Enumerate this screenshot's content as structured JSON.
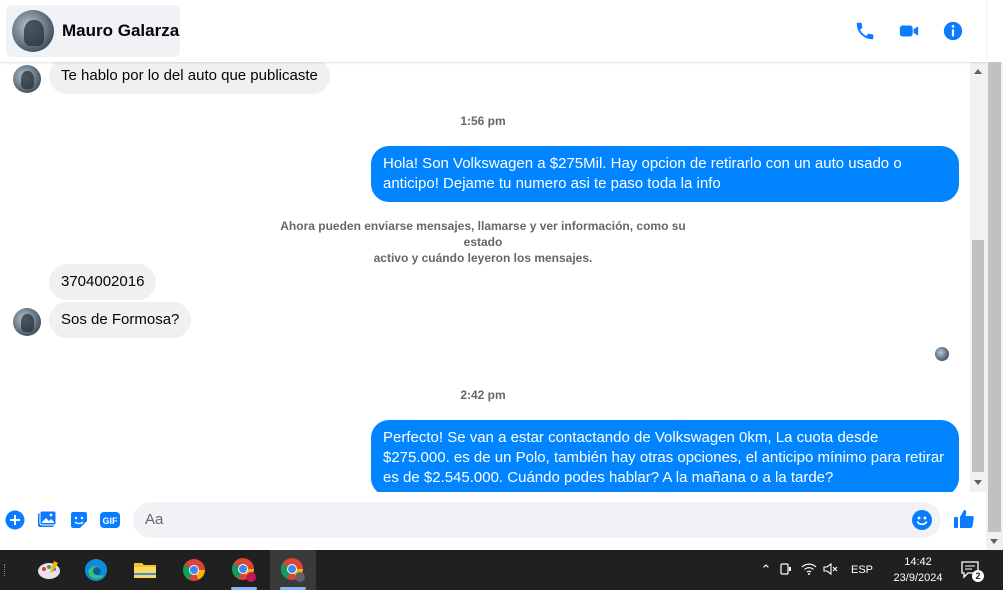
{
  "header": {
    "contact_name": "Mauro Galarza",
    "icons": [
      "phone-icon",
      "video-icon",
      "info-icon"
    ]
  },
  "messages": {
    "m1": "Te hablo por lo del auto que publicaste",
    "time1": "1:56 pm",
    "m2": "Hola! Son Volkswagen a $275Mil. Hay opcion de retirarlo con un auto usado o anticipo! Dejame tu numero asi te paso toda la info",
    "system_line1": "Ahora pueden enviarse mensajes, llamarse y ver información, como su estado",
    "system_line2": "activo y cuándo leyeron los mensajes.",
    "m3": "3704002016",
    "m4": "Sos de Formosa?",
    "time2": "2:42 pm",
    "m5": "Perfecto!  Se van a estar contactando de Volkswagen 0km, La cuota desde $275.000. es de un Polo, también hay otras opciones, el anticipo mínimo para retirar es de $2.545.000. Cuándo podes hablar? A la mañana o a la tarde?"
  },
  "composer": {
    "placeholder": "Aa",
    "icons": [
      "plus-icon",
      "image-icon",
      "sticker-icon",
      "gif-icon",
      "emoji-icon",
      "thumbs-up-icon"
    ],
    "gif_label": "GIF"
  },
  "taskbar": {
    "apps": [
      "paint-icon",
      "edge-icon",
      "file-explorer-icon",
      "chrome-icon",
      "chrome-profile-icon",
      "chrome-incognito-icon"
    ],
    "language": "ESP",
    "time": "14:42",
    "date": "23/9/2024",
    "notification_count": "2"
  },
  "colors": {
    "accent": "#0084ff",
    "incoming_bubble": "#f0f0f0",
    "taskbar": "#202020"
  }
}
